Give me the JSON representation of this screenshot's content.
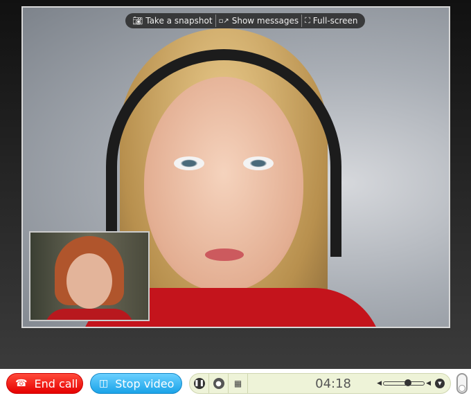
{
  "overlay": {
    "snapshot": "Take a snapshot",
    "messages": "Show messages",
    "fullscreen": "Full-screen"
  },
  "bar": {
    "end_call": "End call",
    "stop_video": "Stop video",
    "timer": "04:18",
    "volume_level": 0.6
  },
  "colors": {
    "end_call": "#e60000",
    "stop_video": "#1aa3e8",
    "control_bg": "#eef3d8"
  }
}
